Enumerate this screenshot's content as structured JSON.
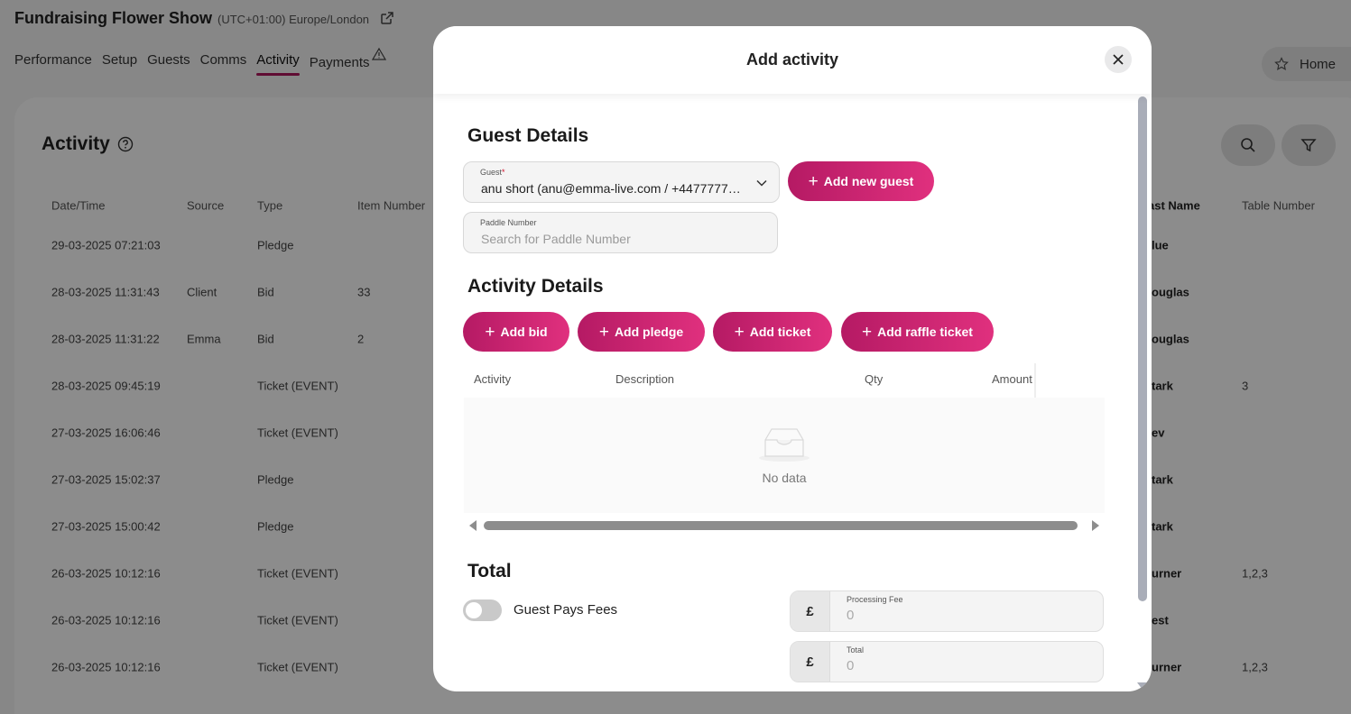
{
  "background": {
    "event_title": "Fundraising Flower Show",
    "event_timezone": "(UTC+01:00) Europe/London",
    "nav_tabs": [
      "Performance",
      "Setup",
      "Guests",
      "Comms",
      "Activity",
      "Payments"
    ],
    "active_tab": "Activity",
    "home_label": "Home",
    "section_title": "Activity",
    "table_headers": [
      "Date/Time",
      "Source",
      "Type",
      "Item Number",
      "ast Name",
      "Table Number"
    ],
    "rows": [
      {
        "datetime": "29-03-2025 07:21:03",
        "source": "",
        "type": "Pledge",
        "item": "",
        "lastname": "lue",
        "table": ""
      },
      {
        "datetime": "28-03-2025 11:31:43",
        "source": "Client",
        "type": "Bid",
        "item": "33",
        "lastname": "ouglas",
        "table": ""
      },
      {
        "datetime": "28-03-2025 11:31:22",
        "source": "Emma",
        "type": "Bid",
        "item": "2",
        "lastname": "ouglas",
        "table": ""
      },
      {
        "datetime": "28-03-2025 09:45:19",
        "source": "",
        "type": "Ticket (EVENT)",
        "item": "",
        "lastname": "tark",
        "table": "3"
      },
      {
        "datetime": "27-03-2025 16:06:46",
        "source": "",
        "type": "Ticket (EVENT)",
        "item": "",
        "lastname": "ev",
        "table": ""
      },
      {
        "datetime": "27-03-2025 15:02:37",
        "source": "",
        "type": "Pledge",
        "item": "",
        "lastname": "tark",
        "table": ""
      },
      {
        "datetime": "27-03-2025 15:00:42",
        "source": "",
        "type": "Pledge",
        "item": "",
        "lastname": "tark",
        "table": ""
      },
      {
        "datetime": "26-03-2025 10:12:16",
        "source": "",
        "type": "Ticket (EVENT)",
        "item": "",
        "lastname": "urner",
        "table": "1,2,3"
      },
      {
        "datetime": "26-03-2025 10:12:16",
        "source": "",
        "type": "Ticket (EVENT)",
        "item": "",
        "lastname": "est",
        "table": ""
      },
      {
        "datetime": "26-03-2025 10:12:16",
        "source": "",
        "type": "Ticket (EVENT)",
        "item": "",
        "lastname": "urner",
        "table": "1,2,3"
      }
    ]
  },
  "modal": {
    "title": "Add activity",
    "guest_details_title": "Guest Details",
    "guest_field": {
      "label": "Guest",
      "required_mark": "*",
      "value": "anu short (anu@emma-live.com / +4477777777…"
    },
    "add_guest_label": "Add new guest",
    "paddle_field": {
      "label": "Paddle Number",
      "placeholder": "Search for Paddle Number"
    },
    "activity_details_title": "Activity Details",
    "action_buttons": {
      "bid": "Add bid",
      "pledge": "Add pledge",
      "ticket": "Add ticket",
      "raffle": "Add raffle ticket"
    },
    "table": {
      "headers": [
        "Activity",
        "Description",
        "Qty",
        "Amount"
      ],
      "empty_text": "No data"
    },
    "total_title": "Total",
    "guest_pays_fees_label": "Guest Pays Fees",
    "guest_pays_fees_on": false,
    "processing_fee": {
      "currency": "£",
      "label": "Processing Fee",
      "value": "0"
    },
    "total": {
      "currency": "£",
      "label": "Total",
      "value": "0"
    }
  },
  "colors": {
    "accent": "#c41f6c",
    "overlay": "rgba(0,0,0,0.45)"
  }
}
